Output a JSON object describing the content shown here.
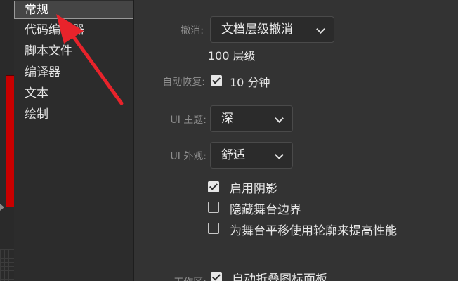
{
  "sidebar": {
    "items": [
      {
        "label": "常规",
        "selected": true
      },
      {
        "label": "代码编辑器",
        "selected": false
      },
      {
        "label": "脚本文件",
        "selected": false
      },
      {
        "label": "编译器",
        "selected": false
      },
      {
        "label": "文本",
        "selected": false
      },
      {
        "label": "绘制",
        "selected": false
      }
    ]
  },
  "general": {
    "undo": {
      "label": "撤消:",
      "value": "文档层级撤消",
      "levels": "100 层级"
    },
    "auto_recover": {
      "label": "自动恢复:",
      "checked": true,
      "value": "10 分钟"
    },
    "ui_theme": {
      "label": "UI 主题:",
      "value": "深"
    },
    "ui_appearance": {
      "label": "UI 外观:",
      "value": "舒适"
    },
    "options": [
      {
        "label": "启用阴影",
        "checked": true
      },
      {
        "label": "隐藏舞台边界",
        "checked": false
      },
      {
        "label": "为舞台平移使用轮廓来提高性能",
        "checked": false
      }
    ],
    "workspace": {
      "label": "工作区:",
      "option_label": "自动折叠图标面板",
      "checked": true
    }
  },
  "colors": {
    "annotation_arrow": "#e8232b",
    "canvas_red": "#c80000"
  },
  "icons": {
    "dropdown": "chevron-down-icon",
    "check": "checkmark-icon"
  }
}
